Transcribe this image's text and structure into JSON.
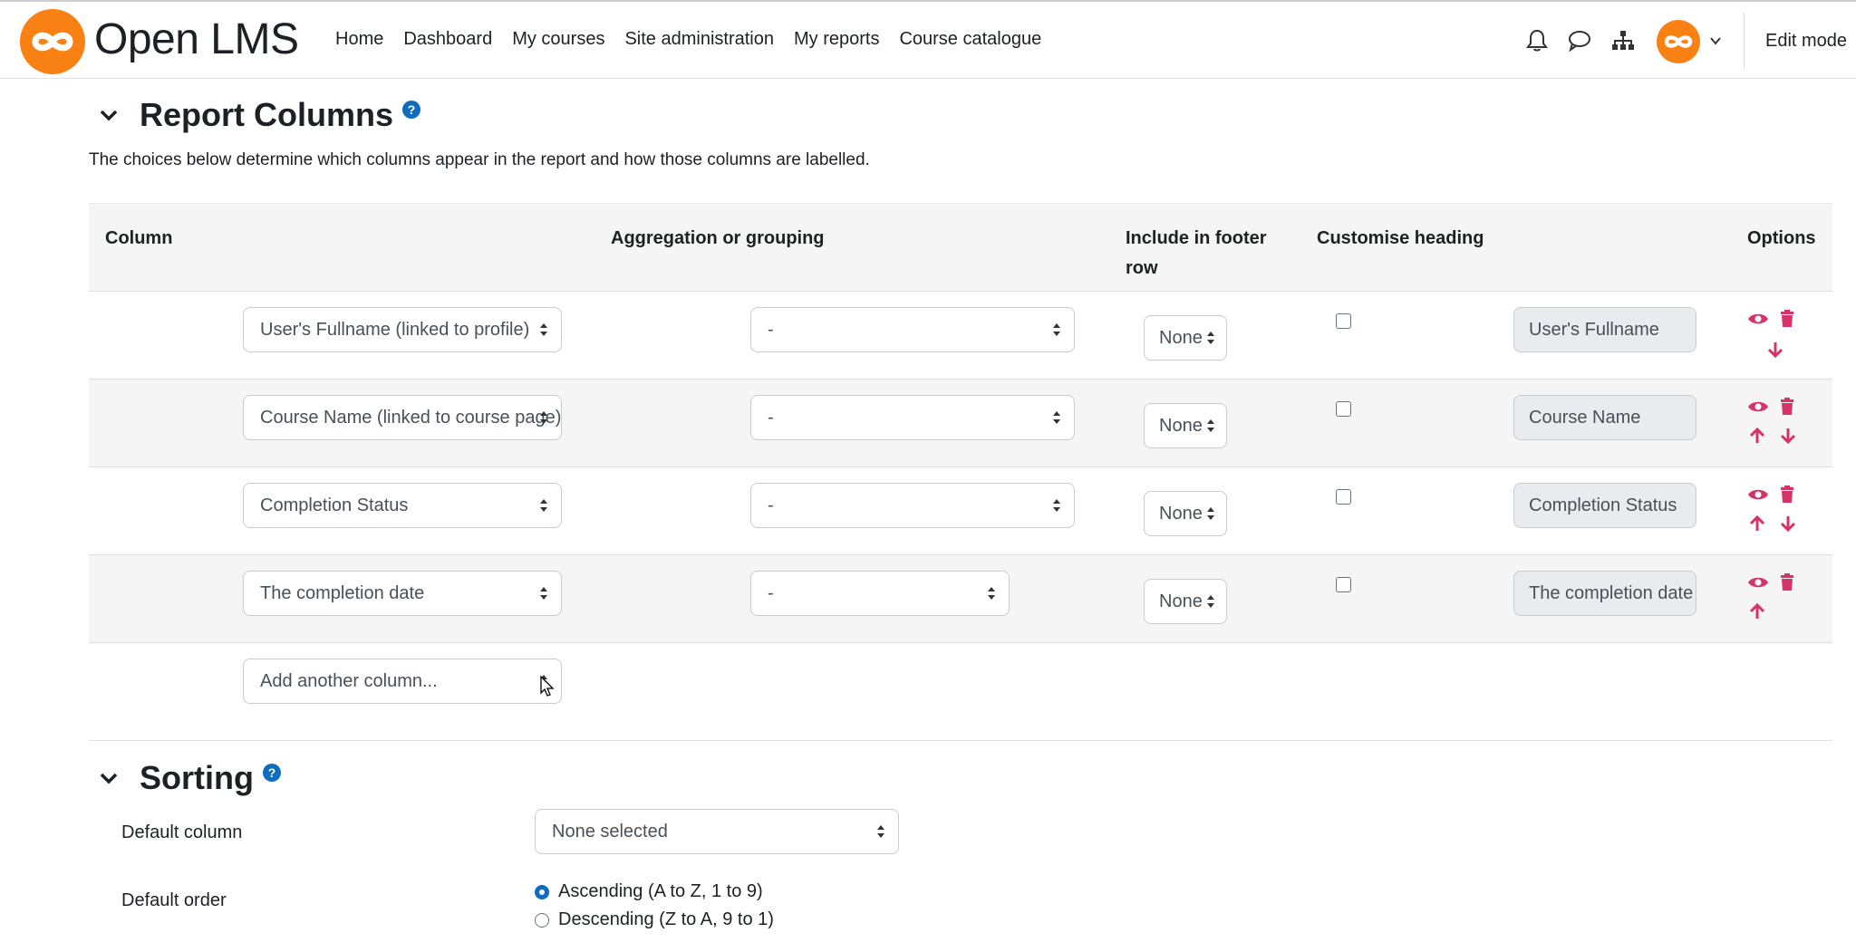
{
  "navbar": {
    "brand": "Open LMS",
    "links": [
      "Home",
      "Dashboard",
      "My courses",
      "Site administration",
      "My reports",
      "Course catalogue"
    ],
    "edit_mode": "Edit mode",
    "accent": "#f98012"
  },
  "report_columns": {
    "title": "Report Columns",
    "help": "?",
    "description": "The choices below determine which columns appear in the report and how those columns are labelled.",
    "headers": {
      "column": "Column",
      "aggregation": "Aggregation or grouping",
      "footer": "Include in footer row",
      "heading": "Customise heading",
      "options": "Options"
    },
    "rows": [
      {
        "column": "User's Fullname (linked to profile)",
        "aggregation": "-",
        "footer": "None",
        "heading": "User's Fullname"
      },
      {
        "column": "Course Name (linked to course page)",
        "aggregation": "-",
        "footer": "None",
        "heading": "Course Name"
      },
      {
        "column": "Completion Status",
        "aggregation": "-",
        "footer": "None",
        "heading": "Completion Status"
      },
      {
        "column": "The completion date",
        "aggregation": "-",
        "footer": "None",
        "heading": "The completion date"
      }
    ],
    "add_column": "Add another column..."
  },
  "sorting": {
    "title": "Sorting",
    "help": "?",
    "default_column_label": "Default column",
    "default_column_value": "None selected",
    "default_order_label": "Default order",
    "ascending": "Ascending (A to Z, 1 to 9)",
    "descending": "Descending (Z to A, 9 to 1)"
  },
  "colors": {
    "action_pink": "#d6336c",
    "link_blue": "#0f6cbf"
  }
}
